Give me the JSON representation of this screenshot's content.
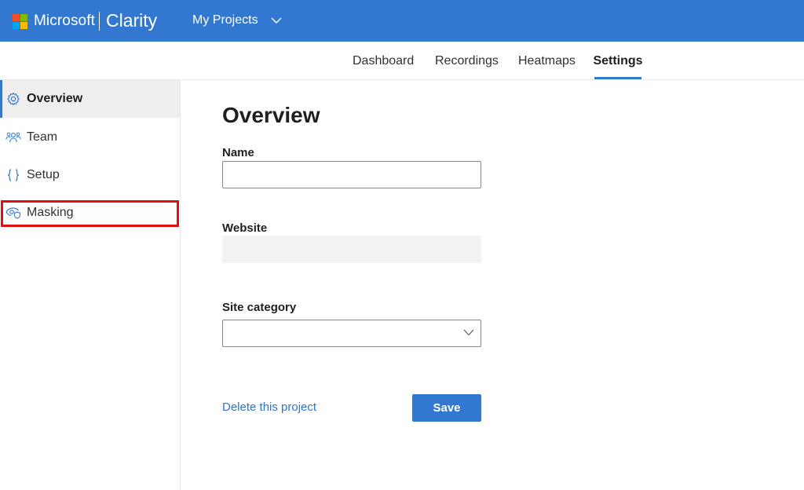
{
  "header": {
    "brand_microsoft": "Microsoft",
    "brand_product": "Clarity",
    "projects_label": "My Projects",
    "logo_colors": [
      "#f25022",
      "#7fba00",
      "#00a4ef",
      "#ffb900"
    ]
  },
  "tabs": [
    {
      "label": "Dashboard",
      "active": false
    },
    {
      "label": "Recordings",
      "active": false
    },
    {
      "label": "Heatmaps",
      "active": false
    },
    {
      "label": "Settings",
      "active": true
    }
  ],
  "sidebar": {
    "items": [
      {
        "label": "Overview",
        "icon": "gear-icon",
        "active": true
      },
      {
        "label": "Team",
        "icon": "team-icon",
        "active": false
      },
      {
        "label": "Setup",
        "icon": "braces-icon",
        "active": false
      },
      {
        "label": "Masking",
        "icon": "eye-shield-icon",
        "active": false,
        "highlighted": true
      }
    ]
  },
  "main": {
    "title": "Overview",
    "name_label": "Name",
    "name_value": "",
    "website_label": "Website",
    "website_value": "",
    "category_label": "Site category",
    "category_value": "",
    "delete_label": "Delete this project",
    "save_label": "Save"
  },
  "colors": {
    "header_bg": "#3278d0",
    "accent": "#3278d0",
    "link": "#2f74c8",
    "highlight": "#e01010"
  }
}
